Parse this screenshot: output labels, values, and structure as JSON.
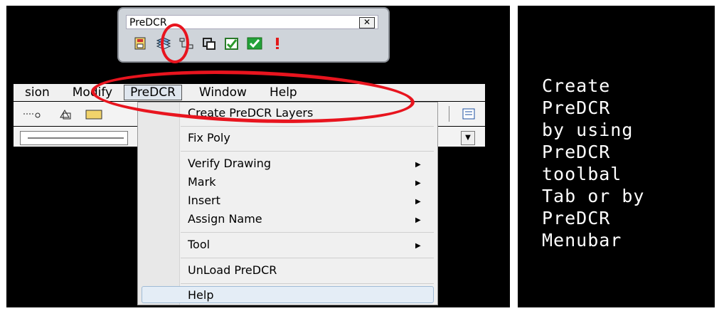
{
  "toolbar": {
    "title": "PreDCR",
    "close_label": "✕",
    "icons": [
      "save-layer-icon",
      "create-layers-icon",
      "tree-icon",
      "copy-icon",
      "check-icon",
      "check-green-icon",
      "alert-icon"
    ]
  },
  "menubar": {
    "items": [
      "sion",
      "Modify",
      "PreDCR",
      "Window",
      "Help"
    ]
  },
  "dropdown": {
    "items": [
      {
        "label": "Create PreDCR Layers",
        "submenu": false
      },
      {
        "label": "Fix Poly",
        "submenu": false
      },
      {
        "label": "Verify Drawing",
        "submenu": true
      },
      {
        "label": "Mark",
        "submenu": true
      },
      {
        "label": "Insert",
        "submenu": true
      },
      {
        "label": "Assign Name",
        "submenu": true
      },
      {
        "label": "Tool",
        "submenu": true
      },
      {
        "label": "UnLoad PreDCR",
        "submenu": false
      },
      {
        "label": "Help",
        "submenu": false
      }
    ]
  },
  "side_text": {
    "lines": [
      "Create",
      "PreDCR",
      "by using",
      "PreDCR",
      "toolbal",
      "Tab or by",
      "PreDCR",
      "Menubar"
    ]
  },
  "colors": {
    "highlight": "#e8141e",
    "background": "#000000"
  }
}
